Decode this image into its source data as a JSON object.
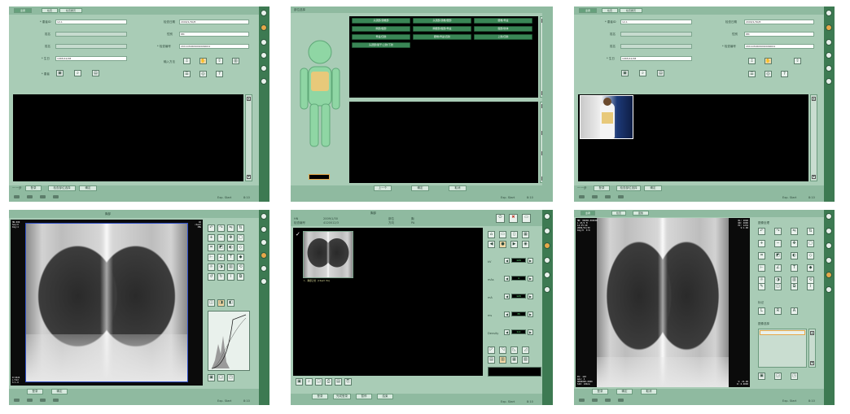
{
  "panels": {
    "p1": {
      "tabs": [
        "患者",
        "检查",
        "检查履历"
      ],
      "left_fields": [
        {
          "label": "* 患者ID",
          "value": "12-1"
        },
        {
          "label": "姓名",
          "value": ""
        },
        {
          "label": "姓名",
          "value": ""
        },
        {
          "label": "* 生日",
          "value": "1965/12/08"
        }
      ],
      "right_fields": [
        {
          "label": "检查日期",
          "value": "2009/1/30/8"
        },
        {
          "label": "性别",
          "value": "8M"
        },
        {
          "label": "* 检查编号",
          "value": "2011032609090009001"
        }
      ],
      "left_icons_label": "* 患者",
      "right_icons_label": "输入方法",
      "bottom_buttons": [
        "登录",
        "检查部位选择",
        "确定"
      ],
      "status_right": "Exp. Start",
      "status_time": "8:10",
      "prev_label": "一·一步"
    },
    "p2": {
      "title": "部位选择",
      "menu": [
        [
          "头颈部/颈椎部",
          "头颈部/颈椎/腰部",
          "腰椎/骨盆"
        ],
        [
          "胸部/腹部",
          "胸腰部/腹部/骨盆",
          "腹部/肢体"
        ],
        [
          "骨盆/四肢",
          "腰椎/骨盆/四肢",
          "上肢/四肢"
        ],
        [
          "头颈部/躯干/上肢/下肢"
        ]
      ],
      "bottom_buttons": [
        "上一个",
        "确定",
        "取消"
      ],
      "status_right": "Exp. Start",
      "status_time": "8:10"
    },
    "p3": {
      "tabs": [
        "患者",
        "检查",
        "检查履历"
      ],
      "left_fields": [
        {
          "label": "* 患者ID",
          "value": "12-1"
        },
        {
          "label": "姓名",
          "value": ""
        },
        {
          "label": "姓名",
          "value": ""
        },
        {
          "label": "* 生日",
          "value": "1965/12/08"
        }
      ],
      "right_fields": [
        {
          "label": "检查日期",
          "value": "2009/1/30/8"
        },
        {
          "label": "性别",
          "value": "8M"
        },
        {
          "label": "* 检查编号",
          "value": "2011032609090009001"
        }
      ],
      "bottom_buttons": [
        "登录",
        "检查部位选择",
        "确定"
      ],
      "status_right": "Exp. Start",
      "status_time": "8:10",
      "prev_label": "一·一步"
    },
    "p4": {
      "title": "胸部",
      "bottom_buttons": [
        "登录",
        "确定"
      ],
      "status_right": "Exp. Start",
      "status_time": "8:10",
      "overlay_tl": "HN.000\nSeq:0\nImg:4",
      "overlay_tr": "CR\nchest\nIMG",
      "overlay_bl": "W:1024\nL:512\nS:1.0"
    },
    "p5": {
      "title": "胸部",
      "info": [
        {
          "label": "HN",
          "value": "2009/1/30"
        },
        {
          "label": "检查编号",
          "value": "4120012/3"
        },
        {
          "label": "部位",
          "value": "胸"
        },
        {
          "label": "方向",
          "value": "PA"
        }
      ],
      "params": [
        {
          "label": "kV",
          "value": "120"
        },
        {
          "label": "mAs",
          "value": "4"
        },
        {
          "label": "mA",
          "value": "120"
        },
        {
          "label": "ms",
          "value": "35"
        },
        {
          "label": "Density",
          "value": "0.0"
        }
      ],
      "thumb_caption": "1. 胸部正位 (Chest PA)",
      "bottom_buttons": [
        "登录",
        "完成登录",
        "暂停",
        "结束"
      ],
      "status_right": "Exp. Start",
      "status_time": "8:10"
    },
    "p6": {
      "tabs": [
        "患者",
        "检查",
        "图像"
      ],
      "section1": "图像处理",
      "section2": "标记",
      "section3": "图像选择",
      "bottom_buttons": [
        "登录",
        "确定",
        "取消"
      ],
      "status_right": "Exp. Start",
      "status_time": "8:10",
      "overlay_tl": "HN: 00000-000000\nL 23/2 M\n12:35:20\n2009/01/30\nImg:0  0:0",
      "overlay_tr": "WL: 2048\nWW: 4096\nEI: 1234\nS:1.00",
      "overlay_bl": "KV: 120\nmAs: 4\n0000000-0000\nSID: 180cm",
      "overlay_br": "S: 24.00\nR: 0.0000"
    }
  },
  "colors": {
    "panel_bg": "#a9ccb6",
    "sidebar": "#3d7a52",
    "accent_orange": "#e6a84a",
    "menu_green": "#3a8656"
  }
}
